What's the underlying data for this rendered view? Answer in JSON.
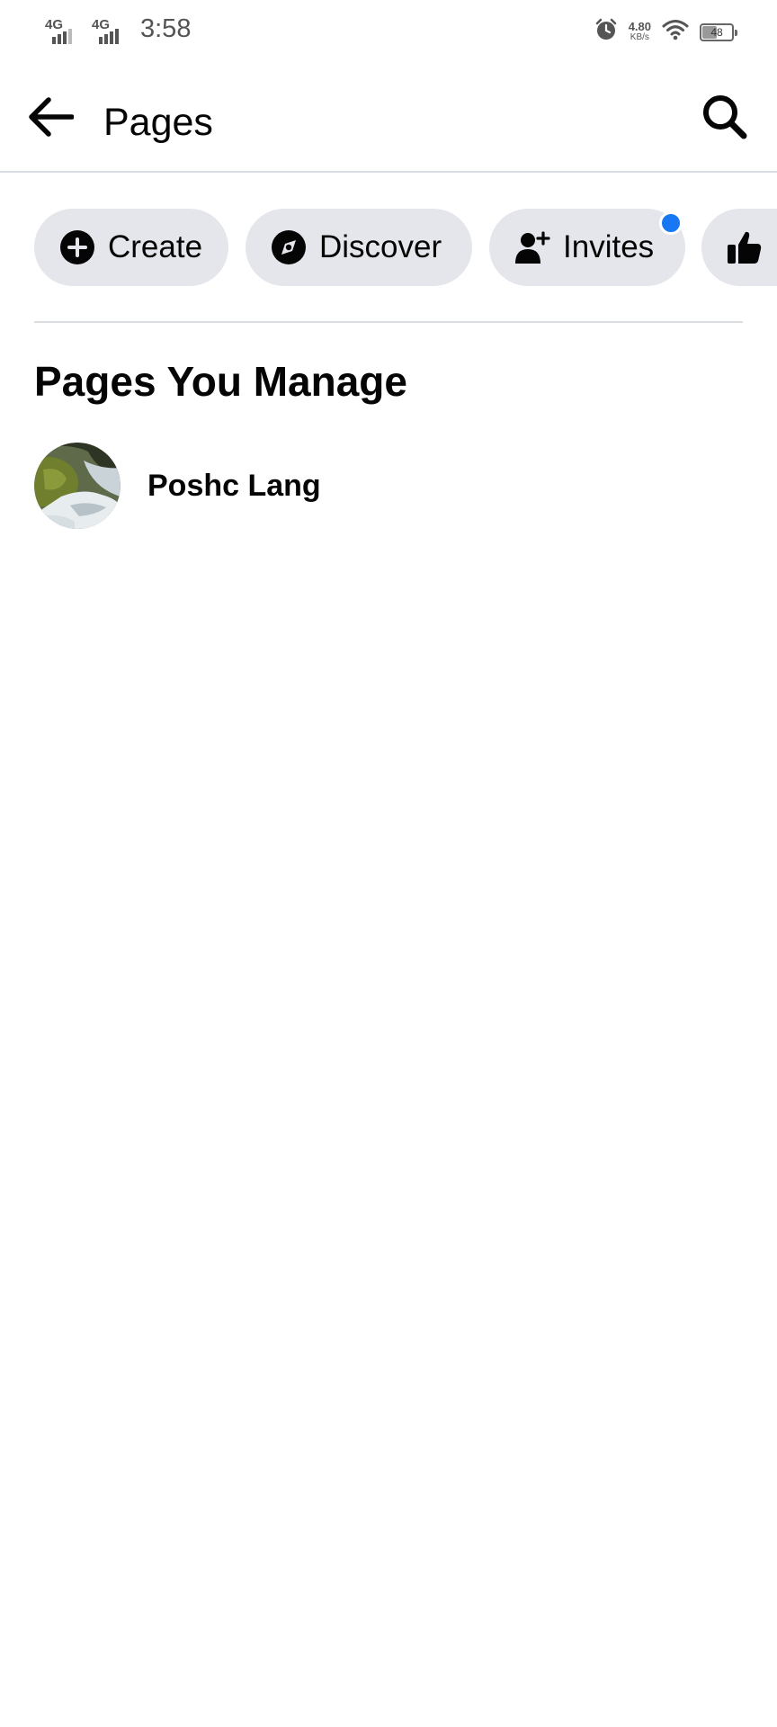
{
  "status_bar": {
    "network1": "4G",
    "network2": "4G",
    "time": "3:58",
    "net_speed_value": "4.80",
    "net_speed_unit": "KB/s",
    "battery_percent": "48",
    "battery_level": 0.48
  },
  "header": {
    "title": "Pages"
  },
  "chips": {
    "create_label": "Create",
    "discover_label": "Discover",
    "invites_label": "Invites"
  },
  "section": {
    "title": "Pages You Manage"
  },
  "pages": [
    {
      "name": "Poshc Lang"
    }
  ],
  "colors": {
    "chip_bg": "#e4e6eb",
    "notification_dot": "#1877f2",
    "text": "#050505",
    "divider": "#dadde1"
  }
}
